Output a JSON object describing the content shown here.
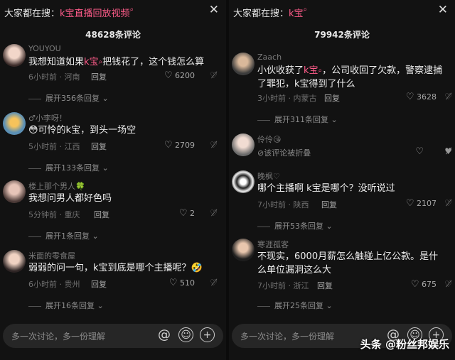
{
  "left": {
    "search_prefix": "大家都在搜：",
    "keyword": "k宝直播回放视频",
    "comment_count": "48628条评论",
    "comments": [
      {
        "user": "YOUYOU",
        "text_pre": "我想知道如果",
        "keyword": "k宝",
        "text_post": "把钱花了，这个钱怎么算",
        "meta": "6小时前 · 河南",
        "reply": "回复",
        "likes": "6200",
        "expand": "展开356条回复"
      },
      {
        "user": "♂小李呀！",
        "text_pre": "😳可怜的k宝，到头一场空",
        "keyword": "",
        "text_post": "",
        "meta": "5小时前 · 江西",
        "reply": "回复",
        "likes": "2709",
        "expand": "展开133条回复"
      },
      {
        "user": "楼上那个男人🍀",
        "text_pre": "我想问男人都好色吗",
        "keyword": "",
        "text_post": "",
        "meta": "5分钟前 · 重庆",
        "reply": "回复",
        "likes": "2",
        "expand": "展开1条回复"
      },
      {
        "user": "米面的零食屋",
        "text_pre": "弱弱的问一句，k宝到底是哪个主播呢？🤣",
        "keyword": "",
        "text_post": "",
        "meta": "6小时前 · 贵州",
        "reply": "回复",
        "likes": "510",
        "expand": "展开16条回复"
      }
    ],
    "input_placeholder": "多一次讨论，多一份理解"
  },
  "right": {
    "search_prefix": "大家都在搜：",
    "keyword": "k宝",
    "comment_count": "79942条评论",
    "comments": [
      {
        "user": "Zaach",
        "text_pre": "小伙收获了",
        "keyword": "k宝",
        "text_post": "，公司收回了欠款，警察逮捕了罪犯，k宝得到了什么",
        "meta": "3小时前 · 内蒙古",
        "reply": "回复",
        "likes": "3628",
        "expand": "展开311条回复"
      },
      {
        "user": "伶伶😘",
        "text_pre": "",
        "keyword": "",
        "text_post": "",
        "folded": "⊘该评论被折叠",
        "meta": "",
        "reply": "",
        "likes": "",
        "expand": ""
      },
      {
        "user": "晚枫♡",
        "text_pre": "哪个主播啊 k宝是哪个？没听说过",
        "keyword": "",
        "text_post": "",
        "meta": "7小时前 · 陕西",
        "reply": "回复",
        "likes": "2107",
        "expand": "展开53条回复"
      },
      {
        "user": "寒涯孤客",
        "text_pre": "不现实，6000月薪怎么触碰上亿公款。是什么单位漏洞这么大",
        "keyword": "",
        "text_post": "",
        "meta": "7小时前 · 浙江",
        "reply": "回复",
        "likes": "675",
        "expand": "展开25条回复"
      }
    ],
    "input_placeholder": "多一次讨论，多一份理解"
  },
  "icons": {
    "close": "close-icon",
    "mention": "at-icon",
    "emoji": "emoji-icon",
    "add": "plus-icon",
    "like": "heart-icon",
    "dislike": "broken-heart-icon",
    "search_keyword": "search-icon"
  },
  "colors": {
    "keyword": "#ff5c8a",
    "background": "#121212"
  },
  "watermark": "头条 @粉丝邦娱乐"
}
